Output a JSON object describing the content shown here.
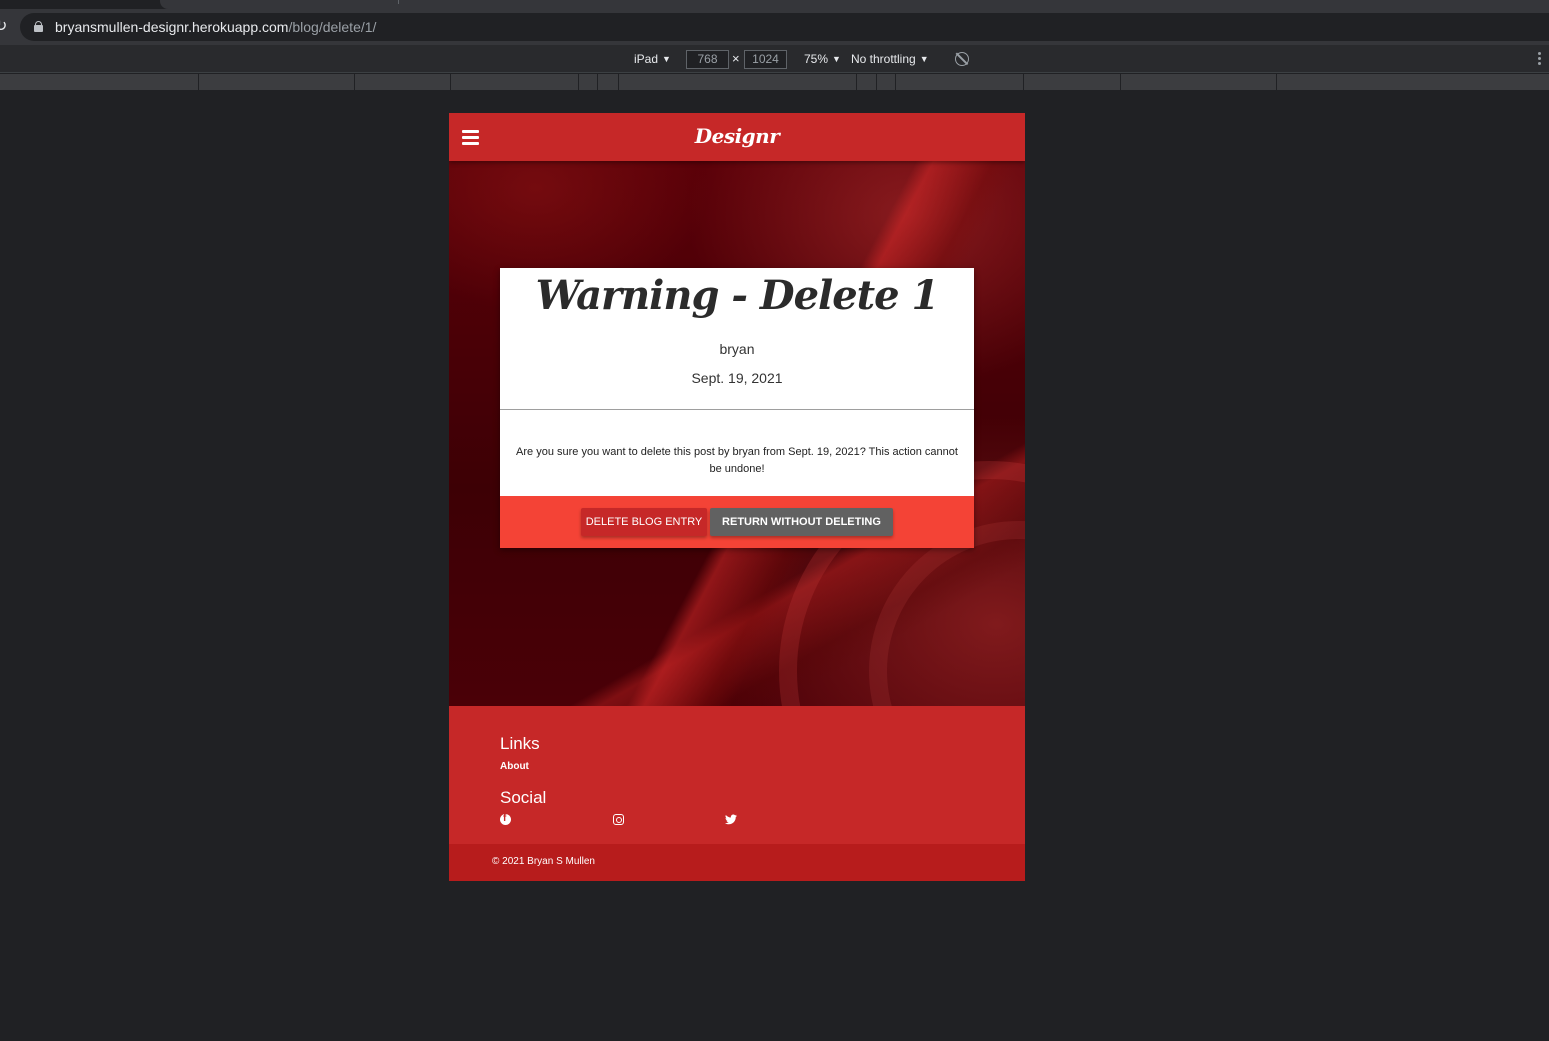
{
  "browser": {
    "url_host": "bryansmullen-designr.herokuapp.com",
    "url_path": "/blog/delete/1/"
  },
  "devtools": {
    "device": "iPad",
    "width": "768",
    "times": "×",
    "height": "1024",
    "zoom": "75%",
    "throttling": "No throttling",
    "icons": [
      "reload-icon",
      "lock-icon",
      "rotate-icon",
      "more-icon"
    ]
  },
  "site": {
    "brand": "Designr",
    "accent": "#c62828",
    "card_action_bg": "#f44336"
  },
  "card": {
    "title": "Warning - Delete 1",
    "author": "bryan",
    "date": "Sept. 19, 2021",
    "message": "Are you sure you want to delete this post by bryan from Sept. 19, 2021? This action cannot be undone!",
    "delete_label": "Delete Blog Entry",
    "return_label": "Return Without Deleting"
  },
  "footer": {
    "links_heading": "Links",
    "about_label": "About",
    "social_heading": "Social",
    "social_icons": [
      "facebook-icon",
      "instagram-icon",
      "twitter-icon"
    ],
    "copyright": "© 2021 Bryan S Mullen"
  }
}
